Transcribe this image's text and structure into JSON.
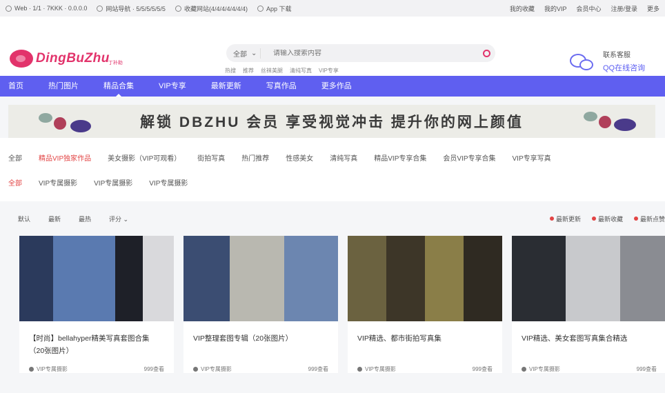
{
  "topbar": {
    "left": [
      {
        "icon": "globe-icon",
        "label": "Web · 1/1 · 7KKK · 0.0.0.0"
      },
      {
        "icon": "grid-icon",
        "label": "网站导航 · 5/5/5/5/5/5"
      },
      {
        "icon": "bookmark-icon",
        "label": "收藏网站(4/4/4/4/4/4/4)"
      },
      {
        "icon": "app-icon",
        "label": "App 下载"
      }
    ],
    "right": [
      "我的收藏",
      "我的VIP",
      "会员中心",
      "注册/登录",
      "更多"
    ]
  },
  "logo": {
    "text": "DingBuZhu",
    "sub": "丁补助"
  },
  "search": {
    "select": "全部",
    "placeholder": "请输入搜索内容",
    "hot": [
      "热搜",
      "推荐",
      "丝袜美腿",
      "清纯写真",
      "VIP专享"
    ]
  },
  "contact": {
    "line1": "联系客服",
    "line2": "QQ在线咨询"
  },
  "nav": [
    "首页",
    "热门图片",
    "精品合集",
    "VIP专享",
    "最新更新",
    "写真作品",
    "更多作品"
  ],
  "nav_active": 2,
  "banner": {
    "text": "解锁 DBZHU 会员 享受视觉冲击 提升你的网上颜值"
  },
  "categories": {
    "row1": [
      "全部",
      "精品VIP独家作品",
      "美女摄影（VIP可观看）",
      "街拍写真",
      "热门推荐",
      "性感美女",
      "清纯写真",
      "精品VIP专享合集",
      "会员VIP专享合集",
      "VIP专享写真"
    ],
    "row2": [
      "全部",
      "VIP专属摄影",
      "VIP专属摄影",
      "VIP专属摄影"
    ],
    "row1_highlight": 1,
    "row2_highlight": 0
  },
  "toolbar": {
    "sorts": [
      "默认",
      "最新",
      "最热",
      "评分 ⌄"
    ],
    "tags": [
      "最新更新",
      "最新收藏",
      "最新点赞"
    ]
  },
  "cards": [
    {
      "title": "【时尚】bellahyper精美写真套图合集（20张图片）",
      "author": "VIP专属摄影",
      "stat": "999查看"
    },
    {
      "title": "VIP整理套图专辑（20张图片）",
      "author": "VIP专属摄影",
      "stat": "999查看"
    },
    {
      "title": "VIP精选、都市街拍写真集",
      "author": "VIP专属摄影",
      "stat": "999查看"
    },
    {
      "title": "VIP精选、美女套图写真集合精选",
      "author": "VIP专属摄影",
      "stat": "999查看"
    }
  ],
  "colors": {
    "brand": "#e2336b",
    "nav": "#5f5ff0",
    "highlight": "#e24444"
  }
}
